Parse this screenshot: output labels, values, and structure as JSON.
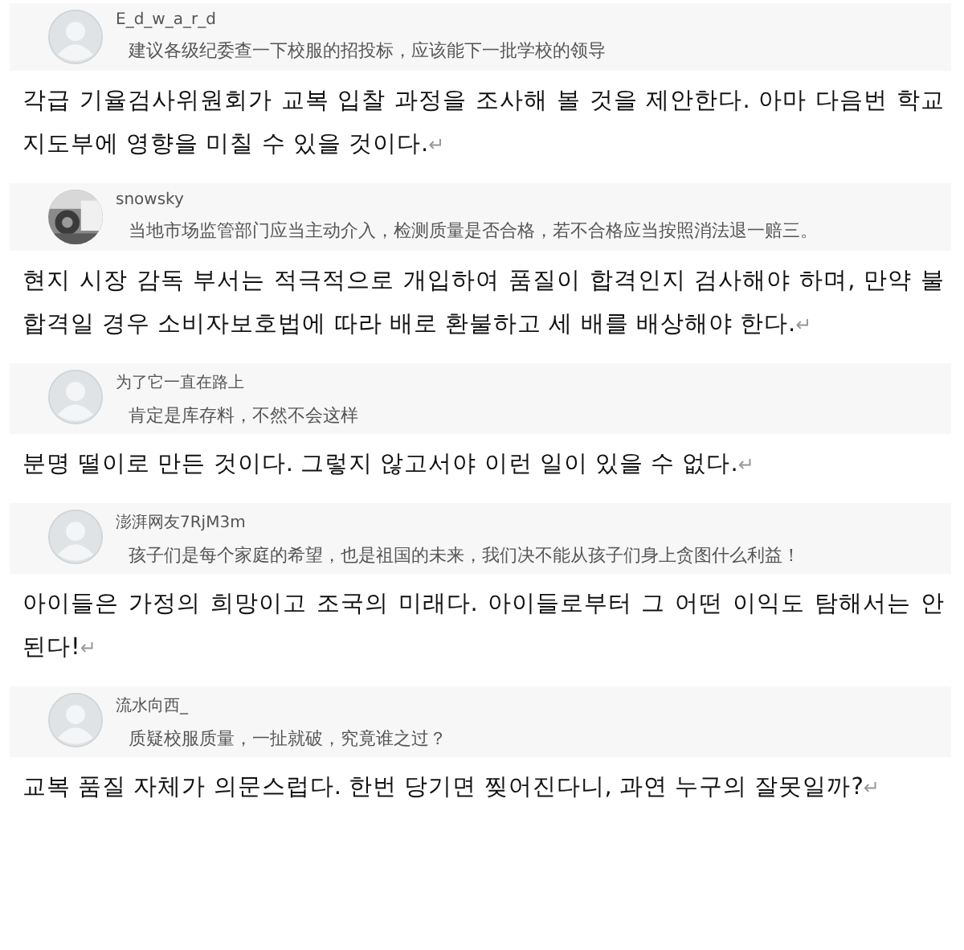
{
  "entries": [
    {
      "avatar": {
        "kind": "default"
      },
      "username": "E_d_w_a_r_d",
      "comment": "建议各级纪委查一下校服的招投标，应该能下一批学校的领导",
      "translation": "각급 기율검사위원회가 교복 입찰 과정을 조사해 볼 것을 제안한다. 아마 다음번 학교 지도부에 영향을 미칠 수 있을 것이다.",
      "mark": "↵"
    },
    {
      "username": "snowsky",
      "comment": "当地市场监管部门应当主动介入，检测质量是否合格，若不合格应当按照消法退一赔三。",
      "translation": "현지 시장 감독 부서는 적극적으로 개입하여 품질이 합격인지 검사해야 하며, 만약 불합격일 경우 소비자보호법에 따라 배로 환불하고 세 배를 배상해야 한다.",
      "mark": "↵"
    },
    {
      "avatar": {
        "kind": "default"
      },
      "username": "为了它一直在路上",
      "comment": "肯定是库存料，不然不会这样",
      "translation": "분명 떨이로 만든 것이다. 그렇지 않고서야 이런 일이 있을 수 없다.",
      "mark": "↵"
    },
    {
      "avatar": {
        "kind": "default"
      },
      "username": "澎湃网友7RjM3m",
      "comment": "孩子们是每个家庭的希望，也是祖国的未来，我们决不能从孩子们身上贪图什么利益！",
      "translation": "아이들은 가정의 희망이고 조국의 미래다. 아이들로부터 그 어떤 이익도 탐해서는 안 된다!",
      "mark": "↵"
    },
    {
      "avatar": {
        "kind": "default"
      },
      "username": "流水向西_",
      "comment": "质疑校服质量，一扯就破，究竟谁之过？",
      "translation": "교복 품질 자체가 의문스럽다. 한번 당기면 찢어진다니, 과연 누구의 잘못일까?",
      "mark": "↵"
    }
  ]
}
